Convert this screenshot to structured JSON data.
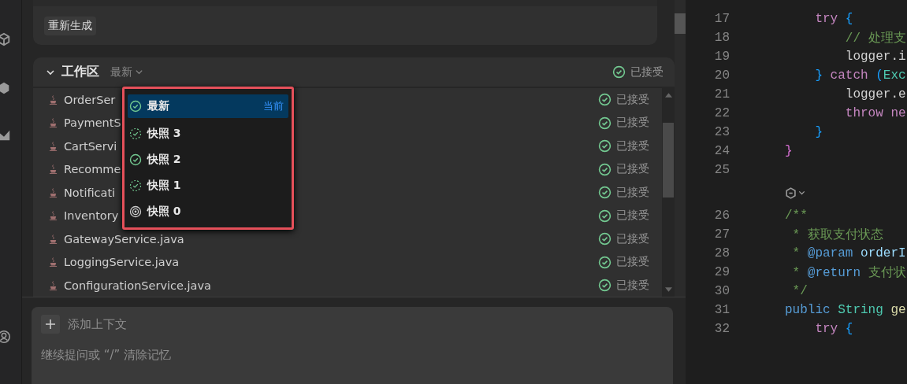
{
  "history_card": {
    "regenerate_button": "重新生成"
  },
  "workspace": {
    "title": "工作区",
    "version": "最新",
    "status": "已接受",
    "expanded": true,
    "files": [
      {
        "name": "OrderSer",
        "status": "已接受"
      },
      {
        "name": "PaymentS",
        "status": "已接受"
      },
      {
        "name": "CartServi",
        "status": "已接受"
      },
      {
        "name": "Recomme",
        "status": "已接受"
      },
      {
        "name": "Notificati",
        "status": "已接受"
      },
      {
        "name": "Inventory",
        "status": "已接受"
      },
      {
        "name": "GatewayService.java",
        "status": "已接受"
      },
      {
        "name": "LoggingService.java",
        "status": "已接受"
      },
      {
        "name": "ConfigurationService.java",
        "status": "已接受"
      }
    ],
    "version_menu": {
      "items": [
        {
          "label": "最新",
          "badge": "当前",
          "selected": true,
          "kind": "accepted"
        },
        {
          "label": "快照 3",
          "selected": false,
          "kind": "pending"
        },
        {
          "label": "快照 2",
          "selected": false,
          "kind": "accepted"
        },
        {
          "label": "快照 1",
          "selected": false,
          "kind": "pending"
        },
        {
          "label": "快照 0",
          "selected": false,
          "kind": "initial"
        }
      ]
    }
  },
  "composer": {
    "add_context": "添加上下文",
    "placeholder": "继续提问或 “/” 清除记忆"
  },
  "editor": {
    "lines": [
      {
        "kind": "code",
        "number": "17",
        "tokens": [
          {
            "text": "    try",
            "kind": "control"
          },
          {
            "text": " {",
            "kind": "brace2"
          }
        ]
      },
      {
        "kind": "code",
        "number": "18",
        "tokens": [
          {
            "text": "        // 处理支",
            "kind": "comment"
          }
        ]
      },
      {
        "kind": "code",
        "number": "19",
        "tokens": [
          {
            "text": "        logger.i",
            "kind": "plain"
          }
        ]
      },
      {
        "kind": "code",
        "number": "20",
        "tokens": [
          {
            "text": "    }",
            "kind": "brace2"
          },
          {
            "text": " catch",
            "kind": "control"
          },
          {
            "text": " (",
            "kind": "brace2"
          },
          {
            "text": "Exc",
            "kind": "type"
          }
        ]
      },
      {
        "kind": "code",
        "number": "21",
        "tokens": [
          {
            "text": "        logger.e",
            "kind": "plain"
          }
        ]
      },
      {
        "kind": "code",
        "number": "22",
        "tokens": [
          {
            "text": "        throw ne",
            "kind": "control"
          }
        ]
      },
      {
        "kind": "code",
        "number": "23",
        "tokens": [
          {
            "text": "    }",
            "kind": "brace2"
          }
        ]
      },
      {
        "kind": "code",
        "number": "24",
        "tokens": [
          {
            "text": "}",
            "kind": "brace1"
          }
        ]
      },
      {
        "kind": "code",
        "number": "25"
      },
      {
        "kind": "codelens"
      },
      {
        "kind": "code",
        "number": "26",
        "tokens": [
          {
            "text": "/**",
            "kind": "comment"
          }
        ]
      },
      {
        "kind": "code",
        "number": "27",
        "tokens": [
          {
            "text": " * 获取支付状态",
            "kind": "comment"
          }
        ]
      },
      {
        "kind": "code",
        "number": "28",
        "tokens": [
          {
            "text": " * ",
            "kind": "comment"
          },
          {
            "text": "@param",
            "kind": "keyword"
          },
          {
            "text": " orderI",
            "kind": "variable"
          }
        ]
      },
      {
        "kind": "code",
        "number": "29",
        "tokens": [
          {
            "text": " * ",
            "kind": "comment"
          },
          {
            "text": "@return",
            "kind": "keyword"
          },
          {
            "text": " 支付状",
            "kind": "comment"
          }
        ]
      },
      {
        "kind": "code",
        "number": "30",
        "tokens": [
          {
            "text": " */",
            "kind": "comment"
          }
        ]
      },
      {
        "kind": "code",
        "number": "31",
        "tokens": [
          {
            "text": "public",
            "kind": "keyword"
          },
          {
            "text": " String",
            "kind": "type"
          },
          {
            "text": " ge",
            "kind": "function"
          }
        ]
      },
      {
        "kind": "code",
        "number": "32",
        "tokens": [
          {
            "text": "    try",
            "kind": "control"
          },
          {
            "text": " {",
            "kind": "brace2"
          }
        ]
      }
    ]
  }
}
